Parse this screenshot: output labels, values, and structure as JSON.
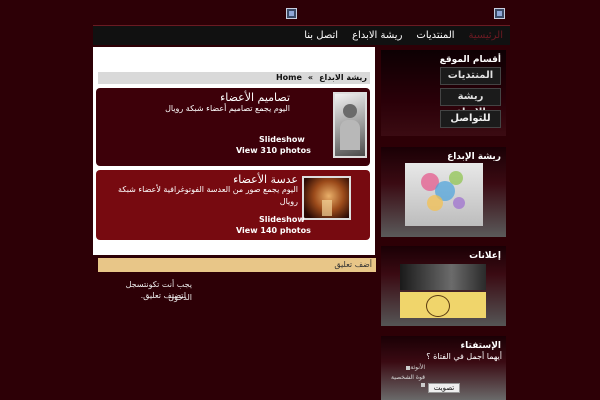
{
  "nav": {
    "items": [
      "الرئيسية",
      "المنتديات",
      "ريشة الابداع",
      "اتصل بنا"
    ],
    "active_index": 0
  },
  "breadcrumb": {
    "home": "Home",
    "separator": "»",
    "current": "ريشة الابداع"
  },
  "albums": [
    {
      "title": "تصاميم الأعضاء",
      "description": "اليوم يجمع تصاميم أعضاء شبكة رويال",
      "slideshow_label": "Slideshow",
      "view_label": "View 310 photos"
    },
    {
      "title": "عدسة الأعضاء",
      "description": "اليوم يجمع صور من العدسة الفوتوغرافية لأعضاء شبكة رويال",
      "slideshow_label": "Slideshow",
      "view_label": "View 140 photos"
    }
  ],
  "comments": {
    "header": "أضف تعليق",
    "note_line1": "يجب أنت تكونتسجل الدخول",
    "note_line2": "لتضيف تعليق."
  },
  "sidebar": {
    "sections_title": "أقسام الموقع",
    "banners": [
      "المنتديات",
      "ريشة الإبداع",
      "للتواصل"
    ],
    "art_title": "ريشة الإبداع",
    "ads_title": "إعلانات",
    "poll_title": "الإستفتاء",
    "poll_question": "أيهما أجمل في الفتاة ؟",
    "poll_options": [
      "الأنوثة",
      "قوة الشخصية"
    ],
    "vote_label": "تصويت"
  },
  "colors": {
    "page_bg": "#2d0006",
    "album_dark": "#3d0009",
    "album_red": "#770a10",
    "comment_bar": "#e8c688"
  }
}
